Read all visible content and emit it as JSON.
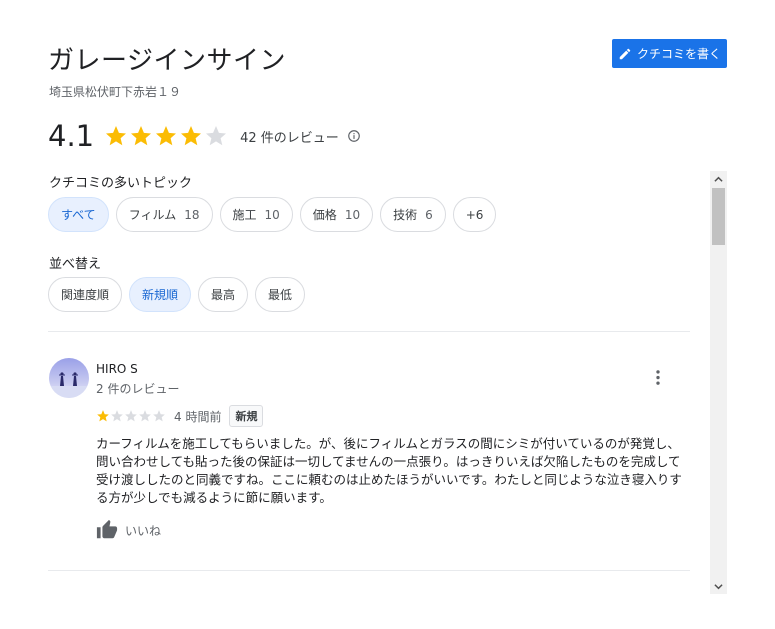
{
  "place": {
    "name": "ガレージインサイン",
    "address": "埼玉県松伏町下赤岩１９"
  },
  "write_review_label": "クチコミを書く",
  "rating": {
    "value": "4.1",
    "stars_filled": 4,
    "review_count_label": "42 件のレビュー"
  },
  "topics": {
    "label": "クチコミの多いトピック",
    "chips": [
      {
        "label": "すべて",
        "count": ""
      },
      {
        "label": "フィルム",
        "count": "18"
      },
      {
        "label": "施工",
        "count": "10"
      },
      {
        "label": "価格",
        "count": "10"
      },
      {
        "label": "技術",
        "count": "6"
      },
      {
        "label": "+6",
        "count": ""
      }
    ]
  },
  "sort": {
    "label": "並べ替え",
    "options": [
      "関連度順",
      "新規順",
      "最高",
      "最低"
    ],
    "selected": "新規順"
  },
  "review": {
    "name": "HIRO S",
    "meta": "2 件のレビュー",
    "stars": 1,
    "time": "4 時間前",
    "badge": "新規",
    "text": "カーフィルムを施工してもらいました。が、後にフィルムとガラスの間にシミが付いているのが発覚し、問い合わせしても貼った後の保証は一切してませんの一点張り。はっきりいえば欠陥したものを完成して受け渡ししたのと同義ですね。ここに頼むのは止めたほうがいいです。わたしと同じような泣き寝入りする方が少しでも減るように節に願います。",
    "like_label": "いいね"
  },
  "colors": {
    "accent": "#1a73e8",
    "star": "#fbbc04",
    "star_empty": "#dadce0",
    "chip_selected_bg": "#e8f0fe"
  }
}
